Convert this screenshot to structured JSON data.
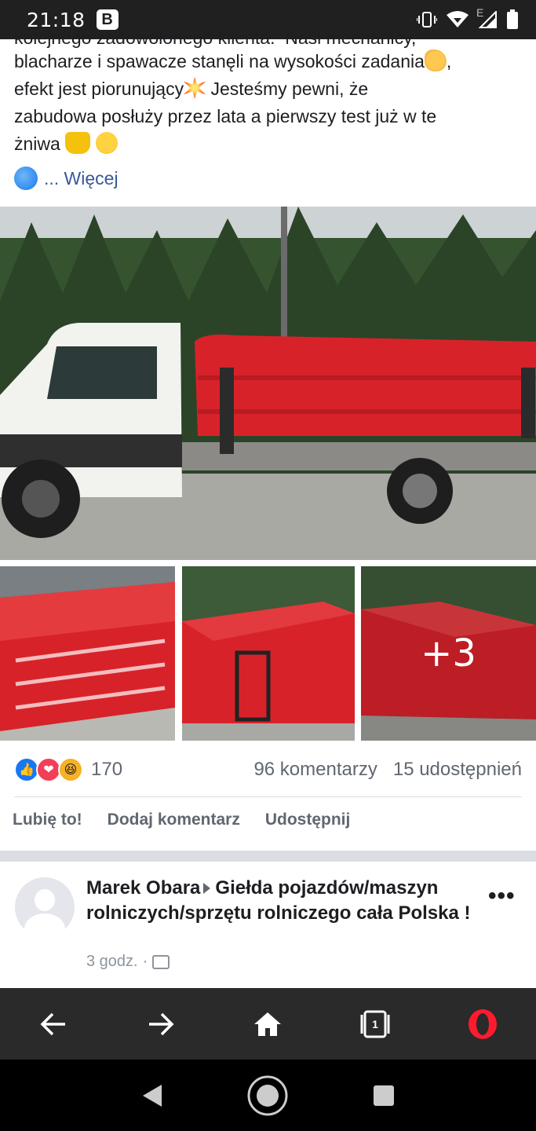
{
  "status_bar": {
    "time": "21:18",
    "app_badge": "B",
    "network_label": "E"
  },
  "post": {
    "text_lines": [
      "kolejnego zadowolonego klienta.  Nasi mechanicy,",
      "blacharze i spawacze stanęli na wysokości zadania",
      "efekt jest piorunujący",
      "Jesteśmy pewni, że",
      "zabudowa posłuży przez lata a pierwszy test już w te",
      "żniwa"
    ],
    "more_label": "... Więcej",
    "more_photos_label": "+3",
    "reaction_count": "170",
    "comments_label": "96 komentarzy",
    "shares_label": "15 udostępnień",
    "actions": {
      "like": "Lubię to!",
      "comment": "Dodaj komentarz",
      "share": "Udostępnij"
    }
  },
  "next_post": {
    "author": "Marek Obara",
    "group": "Giełda pojazdów/maszyn rolniczych/sprzętu rolniczego cała Polska !",
    "time": "3 godz."
  },
  "browser_bar": {
    "tab_count": "1"
  },
  "colors": {
    "accent": "#1877f2",
    "truck_red": "#d8222a",
    "opera_red": "#ff1b2d"
  },
  "icons": {
    "status": [
      "vibrate-icon",
      "wifi-icon",
      "signal-icon",
      "battery-icon"
    ],
    "browser": [
      "back-icon",
      "forward-icon",
      "home-icon",
      "tabs-icon",
      "opera-icon"
    ],
    "android": [
      "nav-back-icon",
      "nav-home-icon",
      "nav-recents-icon"
    ]
  }
}
